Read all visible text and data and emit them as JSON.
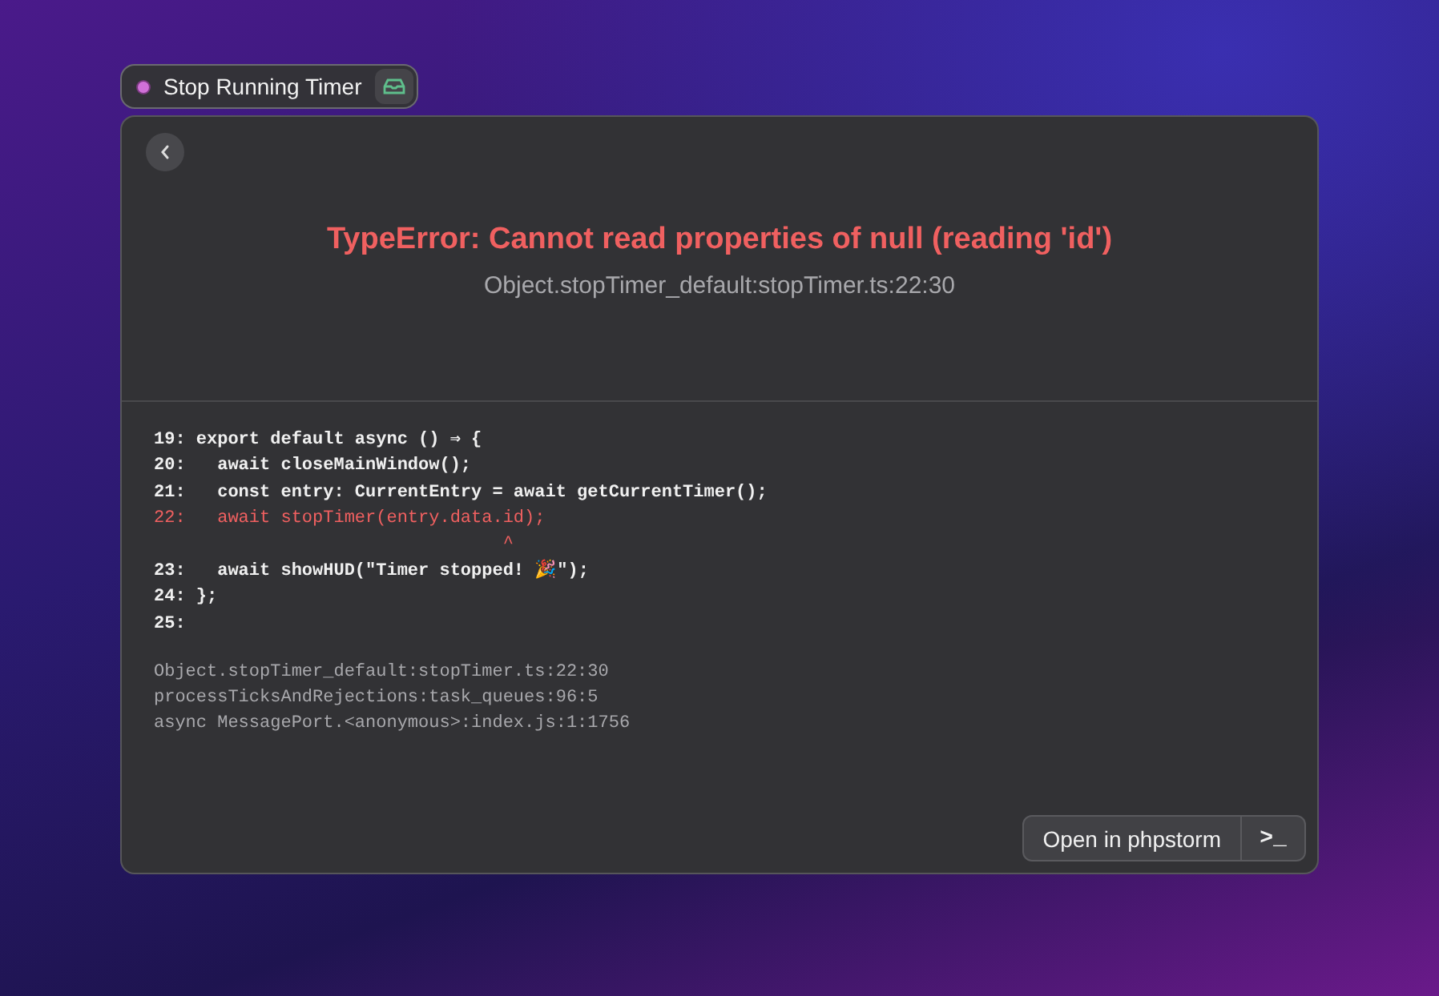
{
  "command": {
    "title": "Stop Running Timer"
  },
  "error": {
    "title": "TypeError: Cannot read properties of null (reading 'id')",
    "location": "Object.stopTimer_default:stopTimer.ts:22:30"
  },
  "code_lines": [
    {
      "number": "19:",
      "code": "export default async () ⇒ {",
      "highlighted": false
    },
    {
      "number": "20:",
      "code": "  await closeMainWindow();",
      "highlighted": false
    },
    {
      "number": "21:",
      "code": "  const entry: CurrentEntry = await getCurrentTimer();",
      "highlighted": false
    },
    {
      "number": "22:",
      "code": "  await stopTimer(entry.data.id);",
      "highlighted": true,
      "marker": "^"
    },
    {
      "number": "23:",
      "code": "  await showHUD(\"Timer stopped! 🎉\");",
      "highlighted": false
    },
    {
      "number": "24:",
      "code": "};",
      "highlighted": false
    },
    {
      "number": "25:",
      "highlighted": false
    }
  ],
  "stack_trace": [
    "Object.stopTimer_default:stopTimer.ts:22:30",
    "processTicksAndRejections:task_queues:96:5",
    "async MessagePort.<anonymous>:index.js:1:1756"
  ],
  "actions": {
    "primary": "Open in phpstorm",
    "secondary": ">_"
  }
}
